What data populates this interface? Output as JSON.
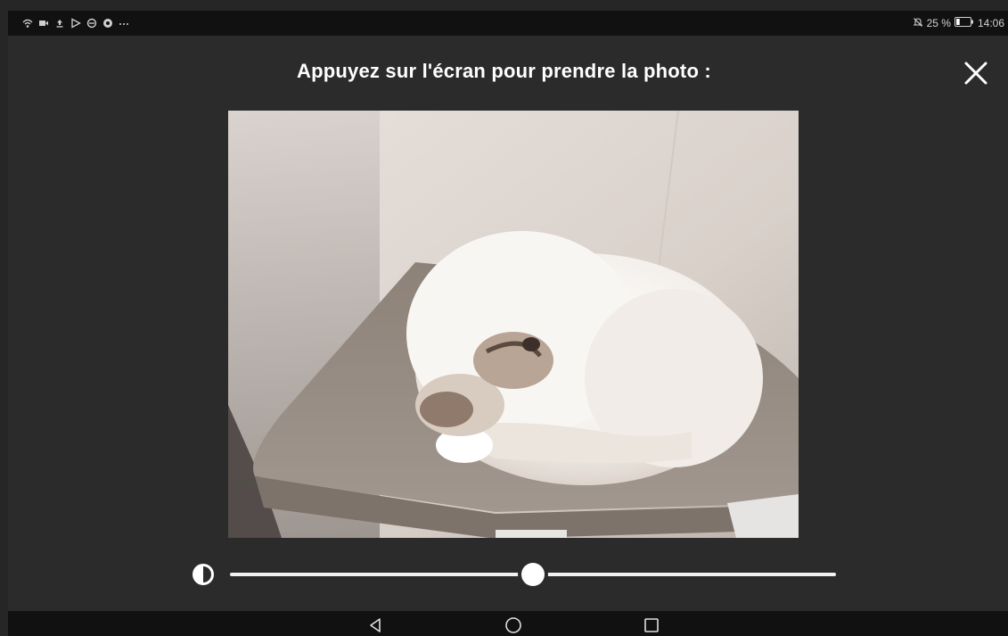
{
  "status_bar": {
    "left_icons": [
      "wifi-icon",
      "video-icon",
      "upload-icon",
      "play-store-icon",
      "e-icon",
      "circle-app-icon",
      "more-dots-icon"
    ],
    "mute_icon": "bell-off-icon",
    "battery_percent": "25 %",
    "battery_level": 0.25,
    "time": "14:06"
  },
  "camera": {
    "prompt": "Appuyez sur l'écran pour prendre la photo :",
    "close_icon": "close-icon",
    "preview_description": "cat-sleeping-on-cat-tree-photo"
  },
  "brightness": {
    "icon": "contrast-icon",
    "value": 0.5
  },
  "nav_bar": {
    "back": "back-icon",
    "home": "home-icon",
    "recents": "recents-icon"
  },
  "colors": {
    "background": "#2b2b2b",
    "bars": "#111111",
    "foreground": "#ffffff"
  }
}
